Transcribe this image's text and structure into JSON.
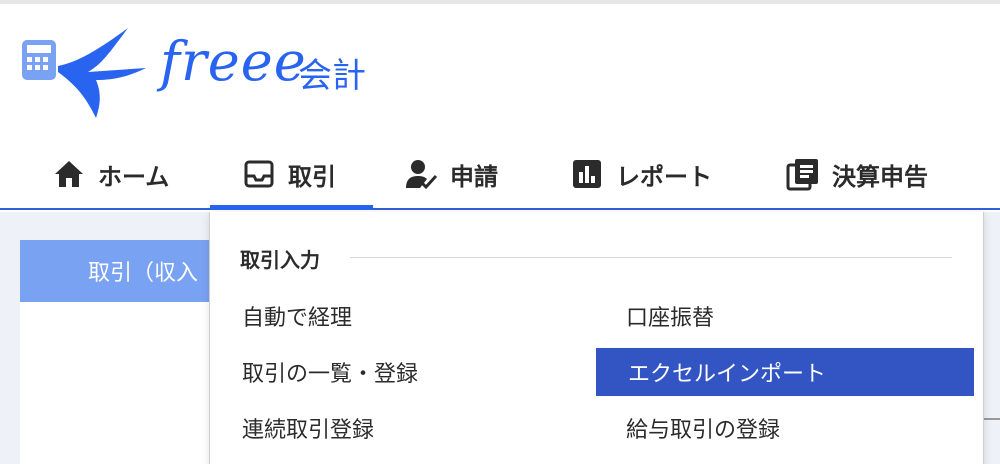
{
  "app": {
    "logo_text": "freee",
    "logo_suffix": "会計"
  },
  "nav": {
    "items": [
      {
        "label": "ホーム",
        "icon": "home-icon"
      },
      {
        "label": "取引",
        "icon": "inbox-tray-icon",
        "active": true
      },
      {
        "label": "申請",
        "icon": "person-check-icon"
      },
      {
        "label": "レポート",
        "icon": "bar-chart-icon"
      },
      {
        "label": "決算申告",
        "icon": "documents-icon"
      }
    ]
  },
  "background": {
    "tab_label": "取引（収入"
  },
  "dropdown": {
    "section_title": "取引入力",
    "items": [
      {
        "label": "自動で経理"
      },
      {
        "label": "口座振替"
      },
      {
        "label": "取引の一覧・登録"
      },
      {
        "label": "エクセルインポート",
        "highlighted": true
      },
      {
        "label": "連続取引登録"
      },
      {
        "label": "給与取引の登録"
      }
    ]
  },
  "colors": {
    "brand_blue": "#2864f0",
    "highlight": "#3355c4",
    "tab_blue": "#7aa2f2"
  }
}
